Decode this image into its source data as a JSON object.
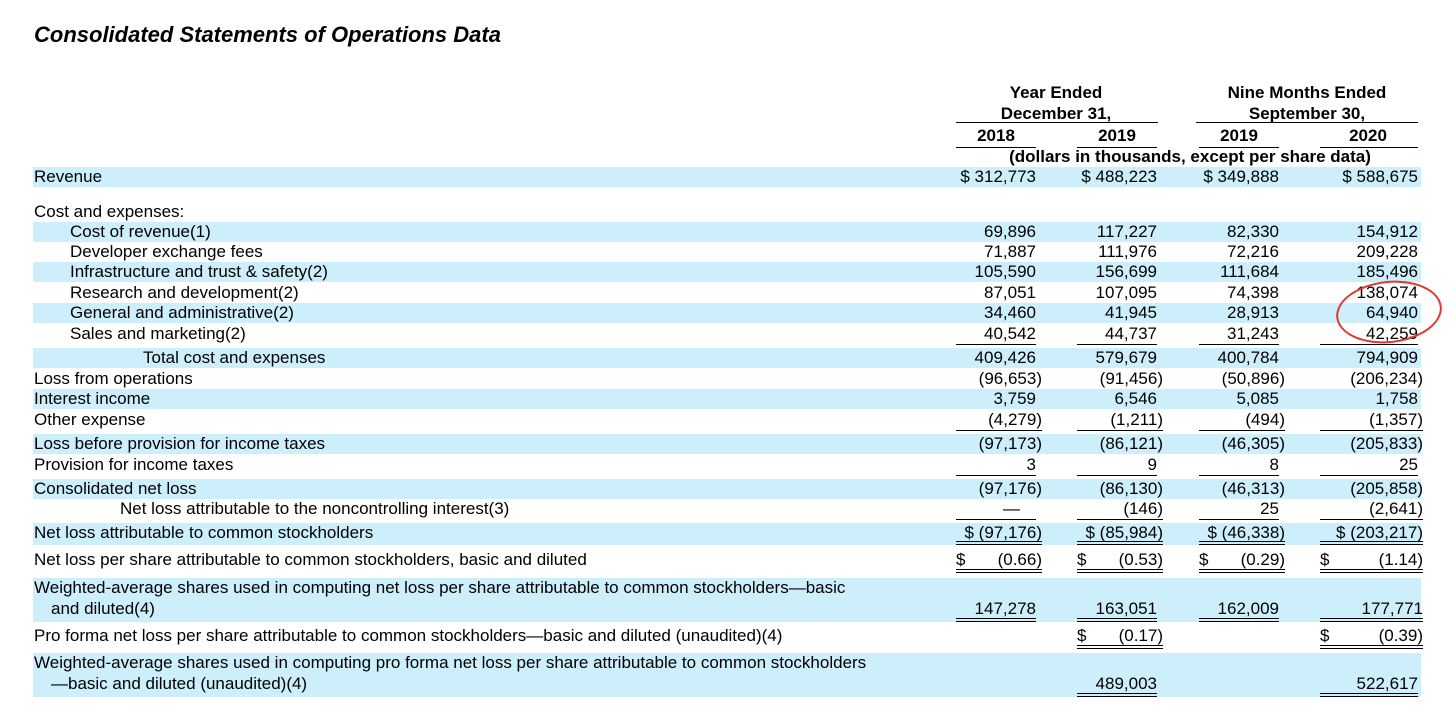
{
  "title": "Consolidated Statements of Operations Data",
  "header": {
    "group1_line1": "Year Ended",
    "group1_line2": "December 31,",
    "group2_line1": "Nine Months Ended",
    "group2_line2": "September 30,",
    "years": [
      "2018",
      "2019",
      "2019",
      "2020"
    ],
    "units": "(dollars in thousands, except per share data)"
  },
  "rows": [
    {
      "label": "Revenue",
      "values": [
        "$ 312,773",
        "$ 488,223",
        "$ 349,888",
        "$   588,675"
      ]
    },
    {
      "label": "Cost and expenses:",
      "values": [
        "",
        "",
        "",
        ""
      ]
    },
    {
      "label": "Cost of revenue(1)",
      "values": [
        "69,896",
        "117,227",
        "82,330",
        "154,912"
      ]
    },
    {
      "label": "Developer exchange fees",
      "values": [
        "71,887",
        "111,976",
        "72,216",
        "209,228"
      ]
    },
    {
      "label": "Infrastructure and trust & safety(2)",
      "values": [
        "105,590",
        "156,699",
        "111,684",
        "185,496"
      ]
    },
    {
      "label": "Research and development(2)",
      "values": [
        "87,051",
        "107,095",
        "74,398",
        "138,074"
      ]
    },
    {
      "label": "General and administrative(2)",
      "values": [
        "34,460",
        "41,945",
        "28,913",
        "64,940"
      ]
    },
    {
      "label": "Sales and marketing(2)",
      "values": [
        "40,542",
        "44,737",
        "31,243",
        "42,259"
      ]
    },
    {
      "label": "Total cost and expenses",
      "values": [
        "409,426",
        "579,679",
        "400,784",
        "794,909"
      ]
    },
    {
      "label": "Loss from operations",
      "values": [
        "(96,653)",
        "(91,456)",
        "(50,896)",
        "(206,234)"
      ]
    },
    {
      "label": "Interest income",
      "values": [
        "3,759",
        "6,546",
        "5,085",
        "1,758"
      ]
    },
    {
      "label": "Other expense",
      "values": [
        "(4,279)",
        "(1,211)",
        "(494)",
        "(1,357)"
      ]
    },
    {
      "label": "Loss before provision for income taxes",
      "values": [
        "(97,173)",
        "(86,121)",
        "(46,305)",
        "(205,833)"
      ]
    },
    {
      "label": "Provision for income taxes",
      "values": [
        "3",
        "9",
        "8",
        "25"
      ]
    },
    {
      "label": "Consolidated net loss",
      "values": [
        "(97,176)",
        "(86,130)",
        "(46,313)",
        "(205,858)"
      ]
    },
    {
      "label": "Net loss attributable to the noncontrolling interest(3)",
      "values": [
        "—",
        "(146)",
        "25",
        "(2,641)"
      ]
    },
    {
      "label": "Net loss attributable to common stockholders",
      "values": [
        "$ (97,176)",
        "$ (85,984)",
        "$ (46,338)",
        "$ (203,217)"
      ]
    },
    {
      "label": "Net loss per share attributable to common stockholders, basic and diluted",
      "dollar": [
        "$",
        "$",
        "$",
        "$"
      ],
      "values": [
        "(0.66)",
        "(0.53)",
        "(0.29)",
        "(1.14)"
      ]
    },
    {
      "label_line1": "Weighted-average shares used in computing net loss per share attributable to common stockholders—basic",
      "label_line2": "and diluted(4)",
      "values": [
        "147,278",
        "163,051",
        "162,009",
        "177,771"
      ]
    },
    {
      "label": "Pro forma net loss per share attributable to common stockholders—basic and diluted (unaudited)(4)",
      "dollar": [
        "",
        "$",
        "",
        "$"
      ],
      "values": [
        "",
        "(0.17)",
        "",
        "(0.39)"
      ]
    },
    {
      "label_line1": "Weighted-average shares used in computing pro forma net loss per share attributable to common stockholders",
      "label_line2": "—basic and diluted (unaudited)(4)",
      "values": [
        "",
        "489,003",
        "",
        "522,617"
      ]
    }
  ],
  "colors": {
    "row_shade": "#cdeefb",
    "annotation_circle": "#e3362d"
  }
}
